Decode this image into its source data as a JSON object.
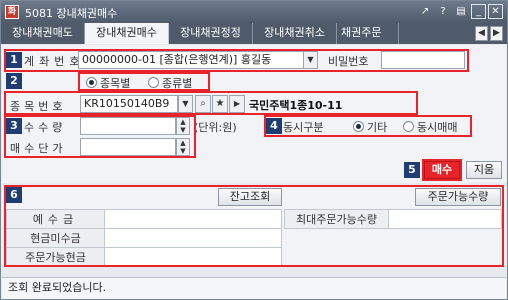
{
  "window": {
    "code_badge": "화",
    "title": "5081 장내채권매수",
    "icons": {
      "pin": "↗",
      "help": "?",
      "menu": "▤",
      "minimize": "_",
      "close": "✕"
    }
  },
  "tabs": [
    {
      "label": "장내채권매도",
      "active": false
    },
    {
      "label": "장내채권매수",
      "active": true
    },
    {
      "label": "장내채권정정",
      "active": false
    },
    {
      "label": "장내채권취소",
      "active": false
    },
    {
      "label": "채권주문",
      "active": false
    }
  ],
  "tab_arrows": {
    "left": "◀",
    "right": "▶"
  },
  "markers": [
    "1",
    "2",
    "3",
    "4",
    "5",
    "6"
  ],
  "account": {
    "label": "계좌번호",
    "value": "00000000-01 [종합(은행연계)] 홍길동",
    "password_label": "비밀번호",
    "password_value": ""
  },
  "search_type": {
    "options": [
      {
        "label": "종목별",
        "selected": true
      },
      {
        "label": "종류별",
        "selected": false
      }
    ]
  },
  "item": {
    "label": "종목번호",
    "code": "KR10150140B9",
    "name": "국민주택1종10-11"
  },
  "quantity": {
    "label": "수수량",
    "value": "",
    "unit": "(단위:원)"
  },
  "price": {
    "label": "매수단가",
    "value": ""
  },
  "simultaneous": {
    "label": "동시구분",
    "options": [
      {
        "label": "기타",
        "selected": true
      },
      {
        "label": "동시매매",
        "selected": false
      }
    ]
  },
  "actions": {
    "buy": "매수",
    "clear": "지움"
  },
  "balance": {
    "check_button": "잔고조회",
    "orderable_qty_button": "주문가능수량",
    "rows": [
      {
        "label": "예수금",
        "value": ""
      },
      {
        "label": "현금미수금",
        "value": ""
      },
      {
        "label": "주문가능현금",
        "value": ""
      }
    ],
    "max_qty_label": "최대주문가능수량",
    "max_qty_value": ""
  },
  "status": "조회 완료되었습니다.",
  "colors": {
    "highlight": "#e8232a",
    "marker": "#1f3d73",
    "titlebar": "#4f5b6b",
    "buy": "#e8232a"
  }
}
